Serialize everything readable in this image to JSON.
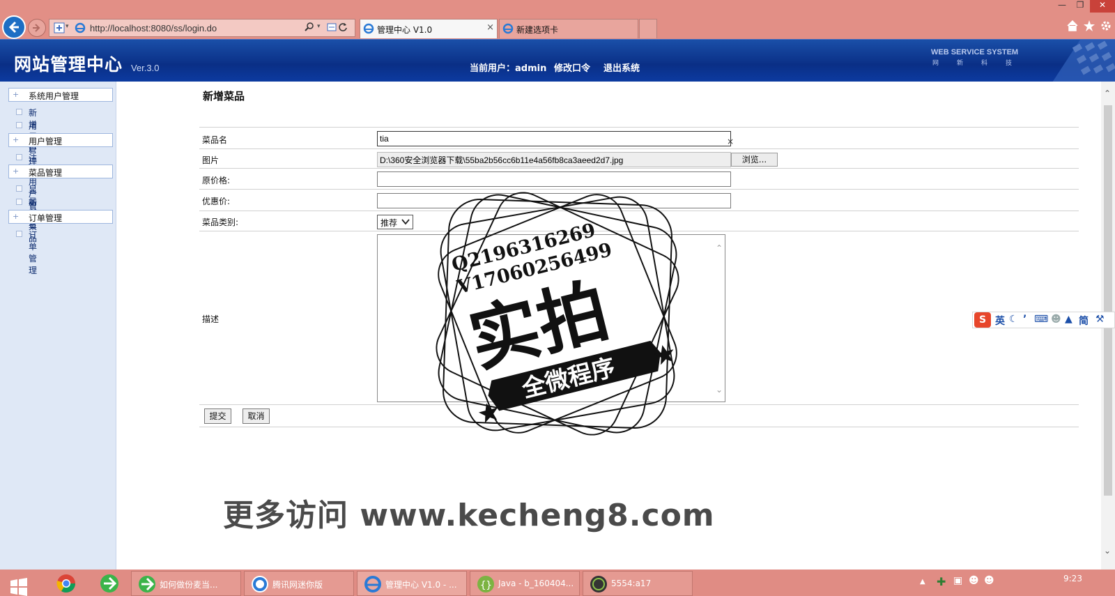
{
  "browser": {
    "url": "http://localhost:8080/ss/login.do",
    "tabs": [
      {
        "label": "管理中心 V1.0",
        "active": true
      },
      {
        "label": "新建选项卡",
        "active": false
      }
    ],
    "tab_close": "×"
  },
  "header": {
    "title": "网站管理中心",
    "version": "Ver.3.0",
    "current_user_label": "当前用户：admin",
    "change_password": "修改口令",
    "logout": "退出系统",
    "brand_en": "WEB SERVICE SYSTEM",
    "brand_cn": "网新科技"
  },
  "sidebar": {
    "groups": [
      {
        "label": "系统用户管理",
        "items": [
          "新增用户",
          "用户管理"
        ]
      },
      {
        "label": "用户管理",
        "items": [
          "注册用户管理"
        ]
      },
      {
        "label": "菜品管理",
        "items": [
          "显示所有",
          "新增菜品"
        ]
      },
      {
        "label": "订单管理",
        "items": [
          "订单管理"
        ]
      }
    ]
  },
  "form": {
    "page_title": "新增菜品",
    "name_label": "菜品名",
    "name_value": "tia",
    "name_clear": "×",
    "image_label": "图片",
    "image_value": "D:\\360安全浏览器下载\\55ba2b56cc6b11e4a56fb8ca3aeed2d7.jpg",
    "browse_button": "浏览...",
    "original_price_label": "原价格:",
    "original_price_value": "",
    "discount_price_label": "优惠价:",
    "discount_price_value": "",
    "category_label": "菜品类别:",
    "category_value": "推荐",
    "description_label": "描述",
    "description_value": "",
    "submit_button": "提交",
    "cancel_button": "取消"
  },
  "watermark": {
    "url_text": "更多访问 www.kecheng8.com",
    "stamp_line1": "Q2196316269",
    "stamp_line2": "V17060256499",
    "stamp_main": "实拍",
    "stamp_ribbon": "全微程序"
  },
  "ime": {
    "logo": "S",
    "lang": "英",
    "mode": "简"
  },
  "taskbar": {
    "items": [
      "如何做份麦当...",
      "腾讯网迷你版",
      "管理中心 V1.0 - ...",
      "Java - b_160404...",
      "5554:a17"
    ],
    "clock": "9:23"
  },
  "colors": {
    "chrome": "#e28f86",
    "header": "#0a2f86",
    "sidebar": "#dfe8f6"
  }
}
